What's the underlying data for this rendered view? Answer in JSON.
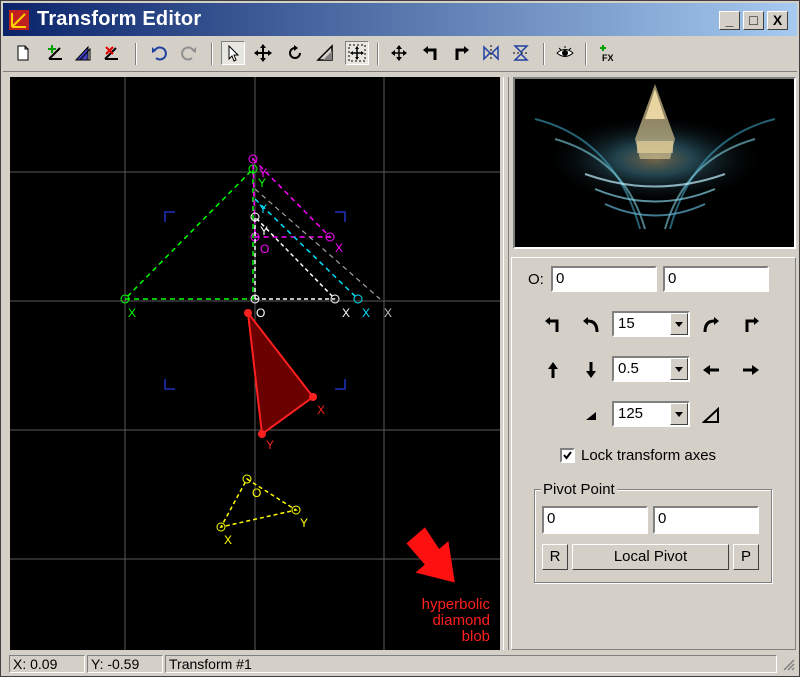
{
  "window": {
    "title": "Transform Editor"
  },
  "titlebar_buttons": [
    "_",
    "□",
    "X"
  ],
  "toolbar": {
    "items": [
      "new-transform",
      "add-transform",
      "duplicate-transform",
      "delete-transform",
      "undo",
      "redo",
      "select",
      "move",
      "rotate",
      "scale",
      "pan-canvas",
      "flip-center",
      "rotate-ccw",
      "rotate-cw",
      "flip-horizontal",
      "flip-vertical",
      "preview-toggle",
      "effects"
    ],
    "pressed": [
      "select",
      "pan-canvas"
    ]
  },
  "transforms": [
    {
      "color": "#00ff00",
      "labels": [
        "O",
        "X",
        "Y"
      ]
    },
    {
      "color": "#ff00ff",
      "labels": [
        "O",
        "X",
        "Y"
      ]
    },
    {
      "color": "#00ffff",
      "labels": [
        "O",
        "X",
        "Y"
      ]
    },
    {
      "color": "#ffffff",
      "labels": [
        "O",
        "X",
        "Y"
      ]
    },
    {
      "color": "#ff0000",
      "labels": [
        "O",
        "X",
        "Y"
      ],
      "selected": true
    },
    {
      "color": "#ffff00",
      "labels": [
        "O",
        "X",
        "Y"
      ]
    }
  ],
  "annotation": {
    "lines": [
      "hyperbolic",
      "diamond",
      "blob"
    ]
  },
  "panel": {
    "origin_label": "O:",
    "origin_x": "0",
    "origin_y": "0",
    "rotate_value": "15",
    "move_value": "0.5",
    "scale_value": "125",
    "lock_axes_label": "Lock transform axes",
    "lock_axes_checked": true,
    "pivot": {
      "title": "Pivot Point",
      "x": "0",
      "y": "0",
      "reset_label": "R",
      "local_label": "Local Pivot",
      "pick_label": "P"
    }
  },
  "status": {
    "x": "X: 0.09",
    "y": "Y: -0.59",
    "transform": "Transform #1"
  }
}
